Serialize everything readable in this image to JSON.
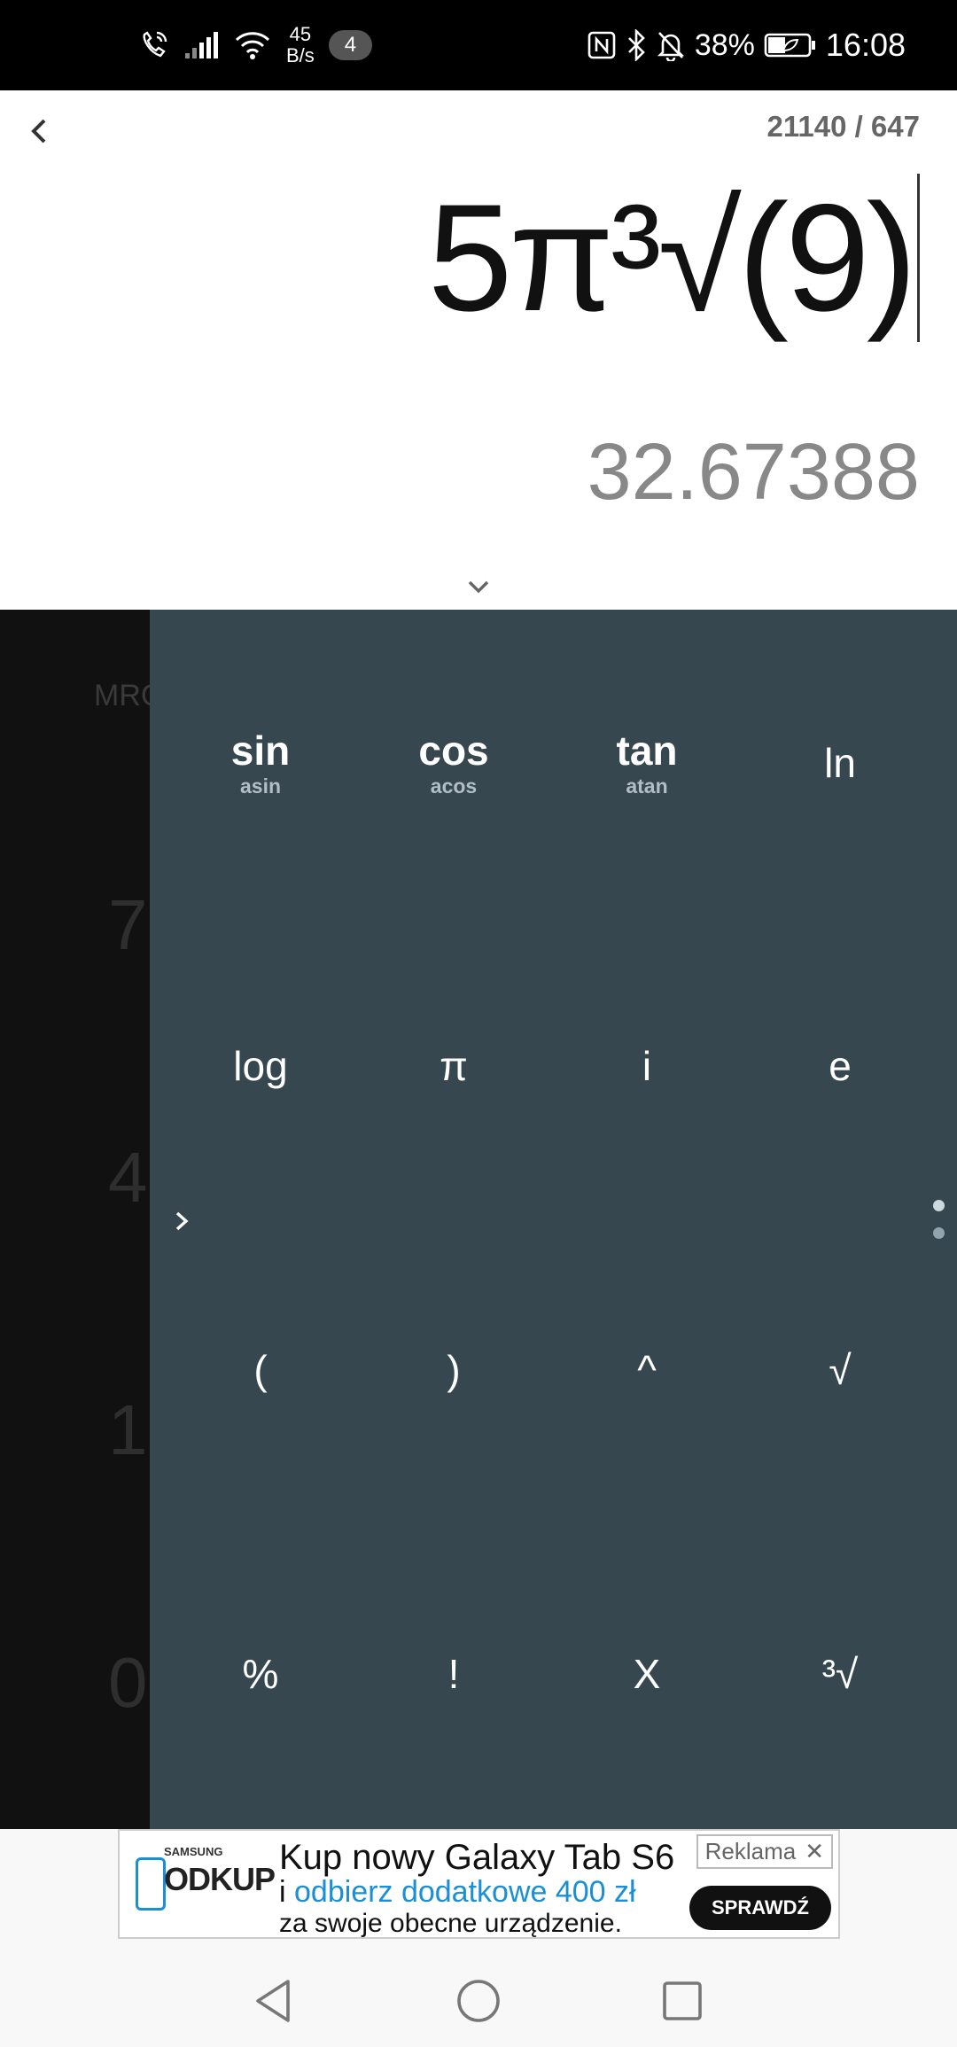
{
  "status_bar": {
    "net_speed_value": "45",
    "net_speed_unit": "B/s",
    "notification_count": "4",
    "battery": "38%",
    "time": "16:08"
  },
  "display": {
    "counter": "21140 / 647",
    "expression": "5π³√(9)",
    "result": "32.67388"
  },
  "numpad": {
    "mrc_label": "MRC",
    "digits": [
      "7",
      "4",
      "1",
      "0"
    ]
  },
  "advanced_keys": [
    {
      "main": "sin",
      "sub": "asin"
    },
    {
      "main": "cos",
      "sub": "acos"
    },
    {
      "main": "tan",
      "sub": "atan"
    },
    {
      "main": "ln",
      "sub": ""
    },
    {
      "main": "log",
      "sub": ""
    },
    {
      "main": "π",
      "sub": ""
    },
    {
      "main": "i",
      "sub": ""
    },
    {
      "main": "e",
      "sub": ""
    },
    {
      "main": "(",
      "sub": ""
    },
    {
      "main": ")",
      "sub": ""
    },
    {
      "main": "^",
      "sub": ""
    },
    {
      "main": "√",
      "sub": ""
    },
    {
      "main": "%",
      "sub": ""
    },
    {
      "main": "!",
      "sub": ""
    },
    {
      "main": "X",
      "sub": ""
    },
    {
      "main": "³√",
      "sub": ""
    }
  ],
  "ad": {
    "brand_small": "SAMSUNG",
    "brand_big": "ODKUP",
    "line1": "Kup nowy Galaxy Tab S6",
    "line2_prefix": "i ",
    "line2_highlight": "odbierz dodatkowe 400 zł",
    "line3": "za swoje obecne urządzenie.",
    "tag": "Reklama",
    "tag_close": "✕",
    "cta": "SPRAWDŹ"
  },
  "colors": {
    "panel_bg": "#37474f",
    "numpad_bg": "#111111",
    "result_text": "#888888",
    "ad_highlight": "#1a8fd6"
  }
}
